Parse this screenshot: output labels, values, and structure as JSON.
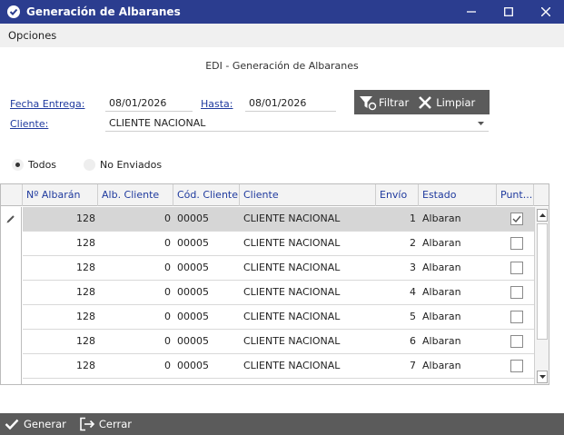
{
  "window": {
    "title": "Generación de Albaranes"
  },
  "menu": {
    "items": [
      {
        "label": "Opciones"
      }
    ]
  },
  "form": {
    "subtitle": "EDI - Generación de Albaranes",
    "fecha_label": "Fecha Entrega:",
    "fecha_value": "08/01/2026",
    "hasta_label": "Hasta:",
    "hasta_value": "08/01/2026",
    "cliente_label": "Cliente:",
    "cliente_value": "CLIENTE NACIONAL"
  },
  "toolbar": {
    "filter_label": "Filtrar",
    "clear_label": "Limpiar"
  },
  "radios": {
    "all_label": "Todos",
    "not_sent_label": "No Enviados",
    "selected": "all"
  },
  "table": {
    "columns": [
      "Nº Albarán",
      "Alb. Cliente",
      "Cód. Cliente",
      "Cliente",
      "Envío",
      "Estado",
      "Punt..."
    ],
    "rows": [
      {
        "albaran": "128",
        "alb_cliente": "0",
        "cod_cliente": "00005",
        "cliente": "CLIENTE NACIONAL",
        "envio": "1",
        "estado": "Albaran",
        "checked": true
      },
      {
        "albaran": "128",
        "alb_cliente": "0",
        "cod_cliente": "00005",
        "cliente": "CLIENTE NACIONAL",
        "envio": "2",
        "estado": "Albaran",
        "checked": false
      },
      {
        "albaran": "128",
        "alb_cliente": "0",
        "cod_cliente": "00005",
        "cliente": "CLIENTE NACIONAL",
        "envio": "3",
        "estado": "Albaran",
        "checked": false
      },
      {
        "albaran": "128",
        "alb_cliente": "0",
        "cod_cliente": "00005",
        "cliente": "CLIENTE NACIONAL",
        "envio": "4",
        "estado": "Albaran",
        "checked": false
      },
      {
        "albaran": "128",
        "alb_cliente": "0",
        "cod_cliente": "00005",
        "cliente": "CLIENTE NACIONAL",
        "envio": "5",
        "estado": "Albaran",
        "checked": false
      },
      {
        "albaran": "128",
        "alb_cliente": "0",
        "cod_cliente": "00005",
        "cliente": "CLIENTE NACIONAL",
        "envio": "6",
        "estado": "Albaran",
        "checked": false
      },
      {
        "albaran": "128",
        "alb_cliente": "0",
        "cod_cliente": "00005",
        "cliente": "CLIENTE NACIONAL",
        "envio": "7",
        "estado": "Albaran",
        "checked": false
      }
    ]
  },
  "footer": {
    "generate_label": "Generar",
    "close_label": "Cerrar"
  },
  "colors": {
    "title_bar": "#2b3d8f",
    "link_label": "#1f3a9e",
    "toolbar": "#5b5b5b",
    "selected_row": "#d6d6d6"
  },
  "icons": {
    "app": "app-logo-icon",
    "filter": "filter-icon",
    "clear": "x-icon",
    "generate": "check-icon",
    "close": "exit-icon",
    "row_edit": "pencil-icon"
  }
}
